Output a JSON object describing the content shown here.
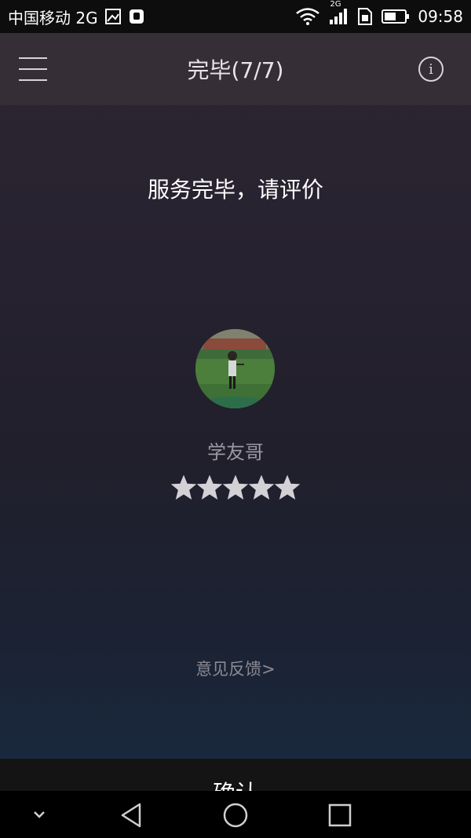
{
  "status_bar": {
    "carrier": "中国移动 2G",
    "network_badge": "2G",
    "time": "09:58",
    "icons": [
      "gallery-notification-icon",
      "app-notification-icon",
      "wifi-icon",
      "signal-icon",
      "sim-icon",
      "battery-icon"
    ]
  },
  "header": {
    "title": "完毕(7/7)",
    "menu_icon": "hamburger-menu-icon",
    "info_icon": "info-icon",
    "info_glyph": "i"
  },
  "main": {
    "prompt": "服务完毕，请评价",
    "driver_name": "学友哥",
    "rating": 5,
    "rating_max": 5,
    "feedback_link": "意见反馈>"
  },
  "footer": {
    "confirm_label": "确认"
  },
  "nav_bar": {
    "icons": [
      "collapse-chevron-icon",
      "back-icon",
      "home-icon",
      "recents-icon"
    ]
  },
  "colors": {
    "header_bg": "#352e36",
    "confirm_bg": "#141414",
    "star": "#d3d1d6",
    "muted_text": "#9d98a2"
  }
}
